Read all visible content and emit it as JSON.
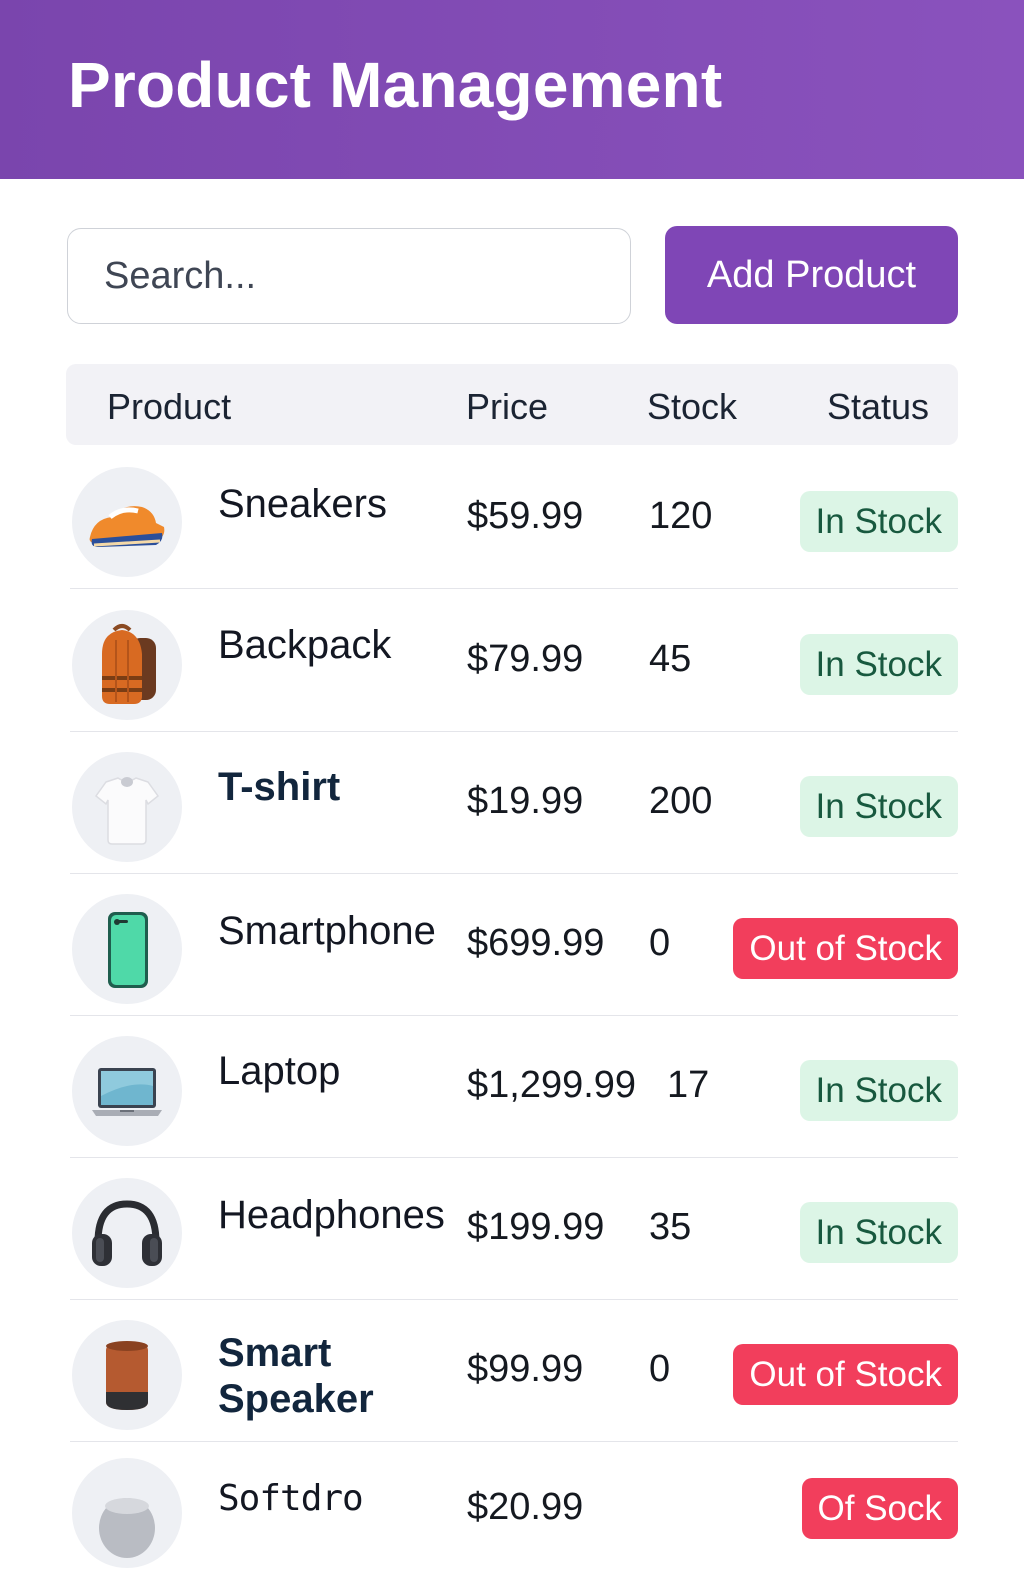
{
  "header": {
    "title": "Product Management"
  },
  "toolbar": {
    "search_placeholder": "Search...",
    "add_label": "Add Product"
  },
  "table": {
    "columns": [
      "Product",
      "Price",
      "Stock",
      "Status"
    ],
    "rows": [
      {
        "name": "Sneakers",
        "price": "$59.99",
        "stock": "120",
        "status": "In Stock",
        "status_type": "in",
        "icon": "sneaker-icon"
      },
      {
        "name": "Backpack",
        "price": "$79.99",
        "stock": "45",
        "status": "In Stock",
        "status_type": "in",
        "icon": "backpack-icon"
      },
      {
        "name": "T-shirt",
        "price": "$19.99",
        "stock": "200",
        "status": "In Stock",
        "status_type": "in",
        "icon": "tshirt-icon"
      },
      {
        "name": "Smartphone",
        "price": "$699.99",
        "stock": "0",
        "status": "Out of Stock",
        "status_type": "out",
        "icon": "smartphone-icon"
      },
      {
        "name": "Laptop",
        "price": "$1,299.99",
        "stock": "17",
        "status": "In Stock",
        "status_type": "in",
        "icon": "laptop-icon"
      },
      {
        "name": "Headphones",
        "price": "$199.99",
        "stock": "35",
        "status": "In Stock",
        "status_type": "in",
        "icon": "headphones-icon"
      },
      {
        "name": "Smart Speaker",
        "name_line1": "Smart",
        "name_line2": "Speaker",
        "price": "$99.99",
        "stock": "0",
        "status": "Out of Stock",
        "status_type": "out",
        "icon": "speaker-icon"
      },
      {
        "name": "Softdro",
        "price": "$20.99",
        "stock": "",
        "status": "Of Sock",
        "status_type": "out",
        "icon": "homepod-icon"
      }
    ]
  },
  "colors": {
    "header": "#7f46b6",
    "accent": "#7f46b6",
    "in_stock_bg": "#dcf5e6",
    "in_stock_text": "#18593f",
    "out_stock_bg": "#f23e5c"
  }
}
